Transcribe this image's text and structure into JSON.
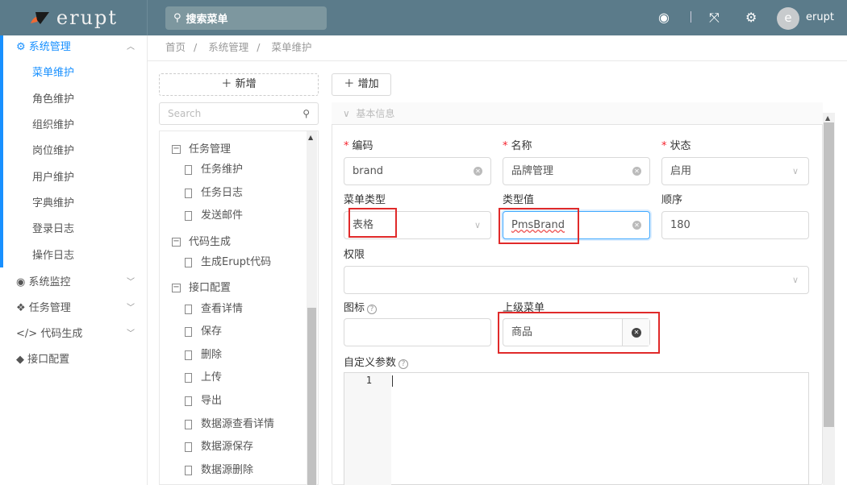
{
  "header": {
    "logo": "erupt",
    "search_placeholder": "搜索菜单",
    "user": "erupt",
    "avatar_letter": "e"
  },
  "sidebar": {
    "groups": [
      {
        "label": "系统管理",
        "expanded": true,
        "items": [
          "菜单维护",
          "角色维护",
          "组织维护",
          "岗位维护",
          "用户维护",
          "字典维护",
          "登录日志",
          "操作日志"
        ],
        "active": "菜单维护"
      },
      {
        "label": "系统监控"
      },
      {
        "label": "任务管理"
      },
      {
        "label": "代码生成"
      },
      {
        "label": "接口配置"
      }
    ]
  },
  "breadcrumb": [
    "首页",
    "系统管理",
    "菜单维护"
  ],
  "tree": {
    "add_label": "新增",
    "search_placeholder": "Search",
    "nodes": [
      {
        "label": "任务管理",
        "type": "folder"
      },
      {
        "label": "任务维护",
        "type": "leaf"
      },
      {
        "label": "任务日志",
        "type": "leaf"
      },
      {
        "label": "发送邮件",
        "type": "leaf"
      },
      {
        "label": "代码生成",
        "type": "folder"
      },
      {
        "label": "生成Erupt代码",
        "type": "leaf"
      },
      {
        "label": "接口配置",
        "type": "folder"
      },
      {
        "label": "查看详情",
        "type": "leaf"
      },
      {
        "label": "保存",
        "type": "leaf"
      },
      {
        "label": "删除",
        "type": "leaf"
      },
      {
        "label": "上传",
        "type": "leaf"
      },
      {
        "label": "导出",
        "type": "leaf"
      },
      {
        "label": "数据源查看详情",
        "type": "leaf"
      },
      {
        "label": "数据源保存",
        "type": "leaf"
      },
      {
        "label": "数据源删除",
        "type": "leaf"
      }
    ]
  },
  "form": {
    "add_label": "增加",
    "section": "基本信息",
    "code": {
      "label": "编码",
      "value": "brand"
    },
    "name": {
      "label": "名称",
      "value": "品牌管理"
    },
    "status": {
      "label": "状态",
      "value": "启用"
    },
    "menu_type": {
      "label": "菜单类型",
      "value": "表格"
    },
    "type_value": {
      "label": "类型值",
      "value": "PmsBrand"
    },
    "order": {
      "label": "顺序",
      "value": "180"
    },
    "permission": {
      "label": "权限",
      "value": ""
    },
    "icon": {
      "label": "图标",
      "value": ""
    },
    "parent": {
      "label": "上级菜单",
      "value": "商品"
    },
    "params": {
      "label": "自定义参数",
      "line": "1"
    }
  },
  "colors": {
    "header": "#5b7b8a",
    "accent": "#1890ff",
    "highlight": "#e02a2a"
  }
}
